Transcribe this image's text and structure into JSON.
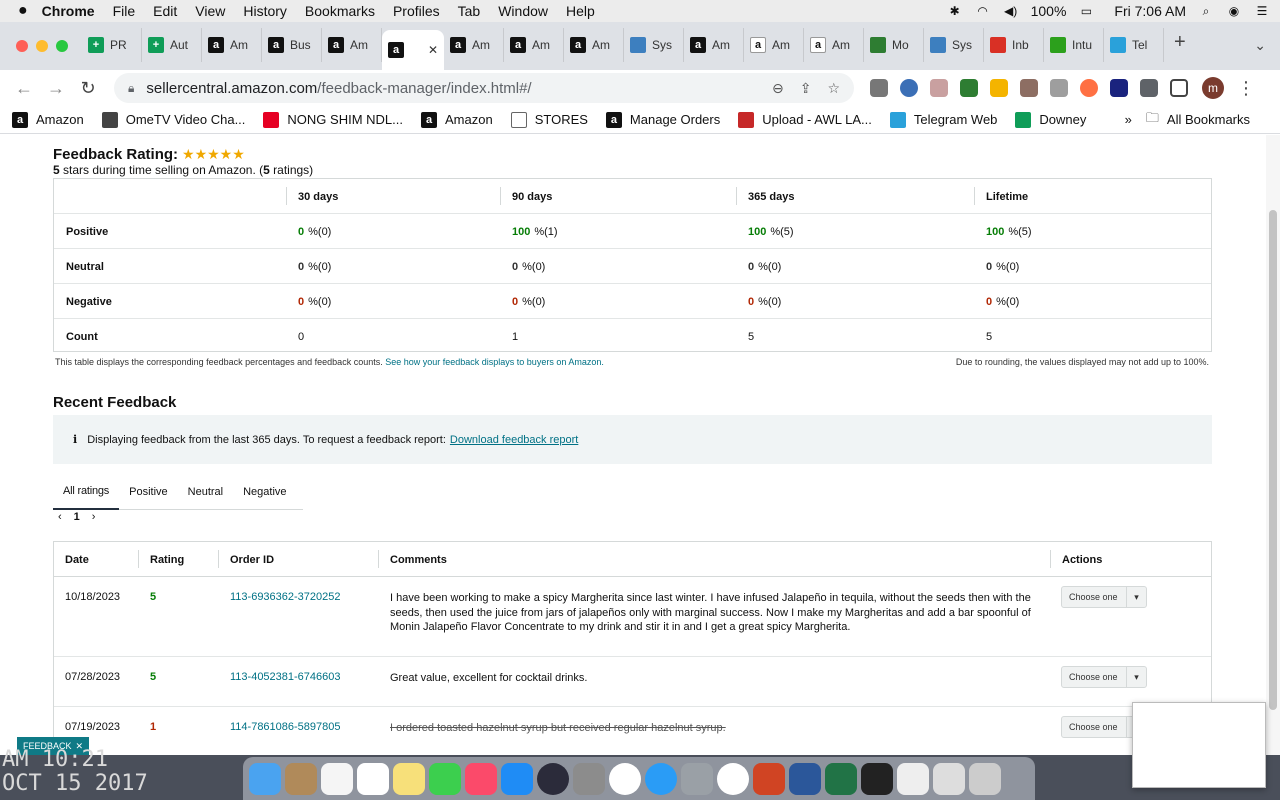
{
  "menubar": {
    "app": "Chrome",
    "items": [
      "File",
      "Edit",
      "View",
      "History",
      "Bookmarks",
      "Profiles",
      "Tab",
      "Window",
      "Help"
    ],
    "volume_battery": "100%",
    "clock": "Fri 7:06 AM"
  },
  "tabs": [
    {
      "label": "PR",
      "icon": "sheets-icon",
      "color": "#0f9d58"
    },
    {
      "label": "Aut",
      "icon": "sheets-icon",
      "color": "#0f9d58"
    },
    {
      "label": "Am",
      "icon": "amazon-icon",
      "color": "#111"
    },
    {
      "label": "Bus",
      "icon": "amazon-icon",
      "color": "#111"
    },
    {
      "label": "Am",
      "icon": "amazon-icon",
      "color": "#111"
    },
    {
      "label": "",
      "icon": "amazon-icon",
      "color": "#111",
      "active": true
    },
    {
      "label": "Am",
      "icon": "amazon-icon",
      "color": "#111"
    },
    {
      "label": "Am",
      "icon": "amazon-icon",
      "color": "#111"
    },
    {
      "label": "Am",
      "icon": "amazon-icon",
      "color": "#111"
    },
    {
      "label": "Sys",
      "icon": "sysco-icon",
      "color": "#3d7fbf"
    },
    {
      "label": "Am",
      "icon": "amazon-icon",
      "color": "#111"
    },
    {
      "label": "Am",
      "icon": "amazon-a-icon",
      "color": "#fff"
    },
    {
      "label": "Am",
      "icon": "amazon-a-icon",
      "color": "#fff"
    },
    {
      "label": "Mo",
      "icon": "monin-icon",
      "color": "#2e7d32"
    },
    {
      "label": "Sys",
      "icon": "sysco-icon",
      "color": "#3d7fbf"
    },
    {
      "label": "Inb",
      "icon": "gmail-icon",
      "color": "#d93025"
    },
    {
      "label": "Intu",
      "icon": "quickbooks-icon",
      "color": "#2ca01c"
    },
    {
      "label": "Tel",
      "icon": "telegram-icon",
      "color": "#2aa1da"
    }
  ],
  "omnibox": {
    "host": "sellercentral.amazon.com",
    "path": "/feedback-manager/index.html#/"
  },
  "bookmarks": [
    {
      "label": "Amazon",
      "icon": "amazon-icon"
    },
    {
      "label": "OmeTV Video Cha...",
      "icon": "ometv-icon"
    },
    {
      "label": "NONG SHIM NDL...",
      "icon": "pinterest-icon"
    },
    {
      "label": "Amazon",
      "icon": "amazon-icon"
    },
    {
      "label": "STORES",
      "icon": "folder-icon"
    },
    {
      "label": "Manage Orders",
      "icon": "amazon-icon"
    },
    {
      "label": "Upload - AWL LA...",
      "icon": "awl-icon"
    },
    {
      "label": "Telegram Web",
      "icon": "telegram-icon"
    },
    {
      "label": "Downey",
      "icon": "sheets-icon"
    }
  ],
  "bookmarks_more": "»",
  "all_bookmarks": "All Bookmarks",
  "feedback_rating": {
    "title": "Feedback Rating:",
    "stars": 5,
    "star_glyphs": "★★★★★",
    "sub_bold1": "5",
    "sub_text1": " stars during time selling on Amazon. (",
    "sub_bold2": "5",
    "sub_text2": " ratings)",
    "columns": [
      "30 days",
      "90 days",
      "365 days",
      "Lifetime"
    ],
    "rows": [
      {
        "label": "Positive",
        "cells": [
          {
            "v": "0",
            "s": "%(0)"
          },
          {
            "v": "100",
            "s": "%(1)"
          },
          {
            "v": "100",
            "s": "%(5)"
          },
          {
            "v": "100",
            "s": "%(5)"
          }
        ]
      },
      {
        "label": "Neutral",
        "cells": [
          {
            "v": "0",
            "s": "%(0)"
          },
          {
            "v": "0",
            "s": "%(0)"
          },
          {
            "v": "0",
            "s": "%(0)"
          },
          {
            "v": "0",
            "s": "%(0)"
          }
        ]
      },
      {
        "label": "Negative",
        "cells": [
          {
            "v": "0",
            "s": "%(0)"
          },
          {
            "v": "0",
            "s": "%(0)"
          },
          {
            "v": "0",
            "s": "%(0)"
          },
          {
            "v": "0",
            "s": "%(0)"
          }
        ]
      },
      {
        "label": "Count",
        "cells": [
          {
            "v": "",
            "s": "0"
          },
          {
            "v": "",
            "s": "1"
          },
          {
            "v": "",
            "s": "5"
          },
          {
            "v": "",
            "s": "5"
          }
        ]
      }
    ],
    "note_text": "This table displays the corresponding feedback percentages and feedback counts. ",
    "note_link": "See how your feedback displays to buyers on Amazon.",
    "rounding_note": "Due to rounding, the values displayed may not add up to 100%."
  },
  "recent": {
    "title": "Recent Feedback",
    "info_text": "Displaying feedback from the last 365 days. To request a feedback report:",
    "info_link": "Download feedback report",
    "filters": [
      "All ratings",
      "Positive",
      "Neutral",
      "Negative"
    ],
    "page": "1",
    "columns": [
      "Date",
      "Rating",
      "Order ID",
      "Comments",
      "Actions"
    ],
    "rows": [
      {
        "date": "10/18/2023",
        "rating": "5",
        "order": "113-6936362-3720252",
        "comment": "I have been working to make a spicy Margherita since last winter. I have infused Jalapeño in tequila, without the seeds then with the seeds, then used the juice from jars of jalapeños only with marginal success. Now I make my Margheritas and add a bar spoonful of Monin Jalapeño Flavor Concentrate to my drink and stir it in and I get a great spicy Margherita.",
        "action": "Choose one"
      },
      {
        "date": "07/28/2023",
        "rating": "5",
        "order": "113-4052381-6746603",
        "comment": "Great value, excellent for cocktail drinks.",
        "action": "Choose one"
      },
      {
        "date": "07/19/2023",
        "rating": "1",
        "order": "114-7861086-5897805",
        "comment": "I ordered toasted hazelnut syrup but received regular hazelnut syrup.",
        "action": "Choose one"
      }
    ]
  },
  "feedback_button": "FEEDBACK",
  "desktop_clock": "AM 10:21\nOCT 15 2017"
}
